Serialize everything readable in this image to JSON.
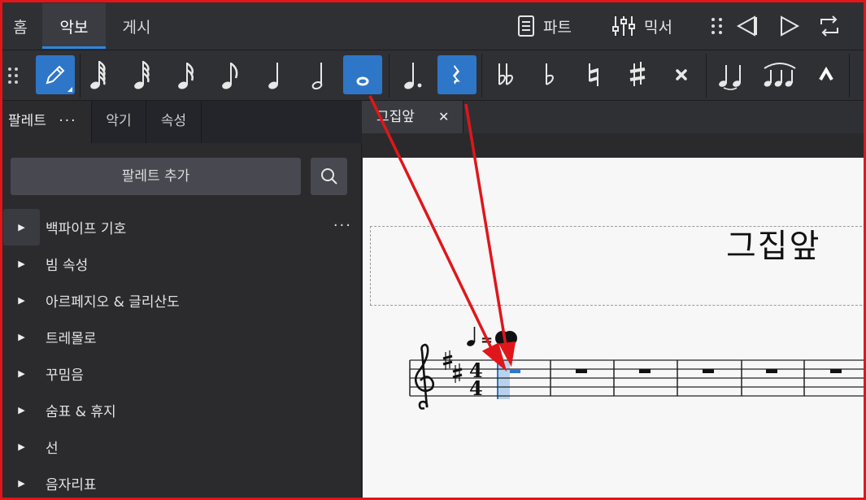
{
  "top_tabs": [
    {
      "label": "홈"
    },
    {
      "label": "악보"
    },
    {
      "label": "게시"
    }
  ],
  "top_buttons": {
    "parts": "파트",
    "mixer": "믹서"
  },
  "note_toolbar": {
    "selected_duration": "whole-note",
    "rest_selected": true,
    "tools": [
      "note-input",
      "64th-note",
      "32nd-note",
      "16th-note",
      "eighth-note",
      "quarter-note",
      "half-note",
      "whole-note",
      "augmentation-dot",
      "rest",
      "double-flat",
      "flat",
      "natural",
      "sharp",
      "double-sharp",
      "tie",
      "slur",
      "marcato"
    ]
  },
  "left_panel": {
    "tabs": [
      {
        "label": "팔레트"
      },
      {
        "label": "악기"
      },
      {
        "label": "속성"
      }
    ],
    "more": "···",
    "add_palette": "팔레트 추가",
    "items": [
      {
        "label": "백파이프 기호"
      },
      {
        "label": "빔 속성"
      },
      {
        "label": "아르페지오 & 글리산도"
      },
      {
        "label": "트레몰로"
      },
      {
        "label": "꾸밈음"
      },
      {
        "label": "숨표 & 휴지"
      },
      {
        "label": "선"
      },
      {
        "label": "음자리표"
      }
    ],
    "item_more": "···"
  },
  "document": {
    "tab_label": "그집앞",
    "close_glyph": "✕",
    "score_title": "그집앞",
    "tempo_equals": "=",
    "time_signature": {
      "top": "4",
      "bottom": "4"
    }
  },
  "colors": {
    "accent": "#2e76c8",
    "annotation_red": "#e0161a"
  }
}
